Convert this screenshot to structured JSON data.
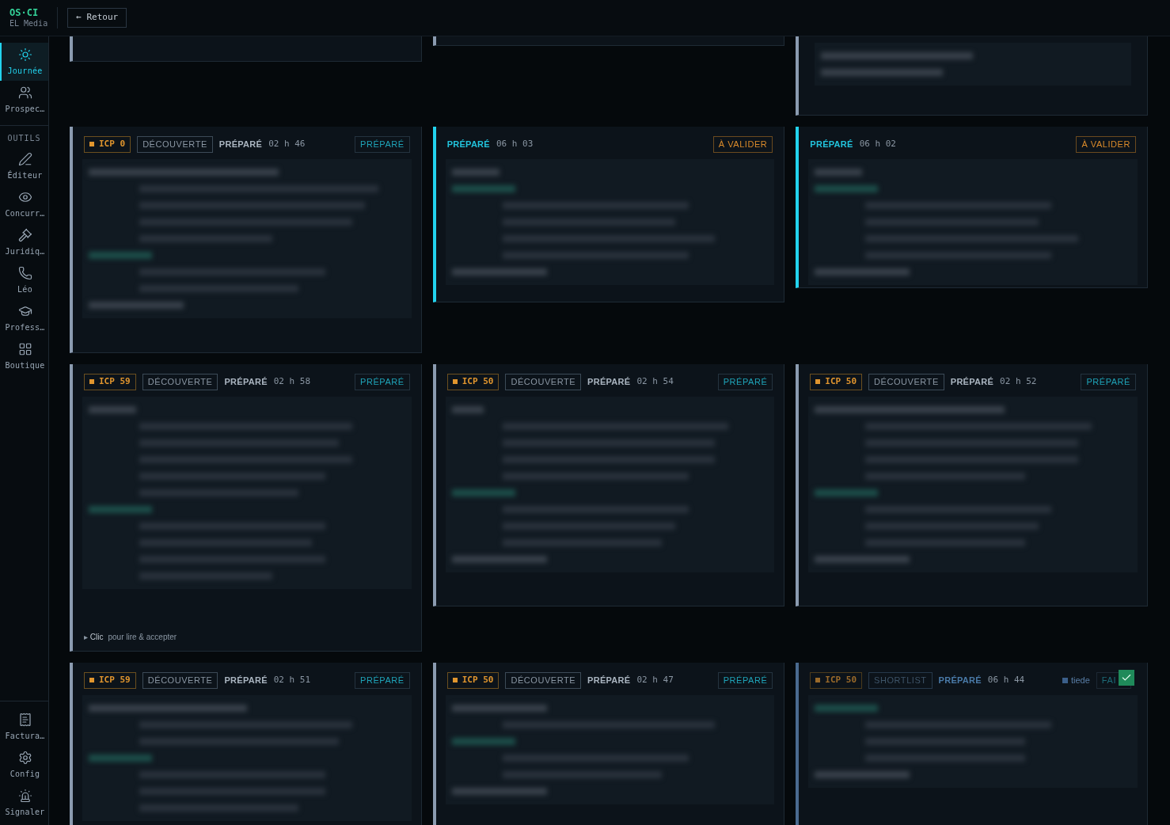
{
  "brand": {
    "name": "OS·CI",
    "subtitle": "EL Media"
  },
  "back_button": "← Retour",
  "sidebar": {
    "main": [
      {
        "label": "Journée",
        "selected": true
      },
      {
        "label": "Prospec…",
        "selected": false
      }
    ],
    "section_label": "OUTILS",
    "tools": [
      {
        "label": "Éditeur",
        "selected": false
      },
      {
        "label": "Concurr…",
        "selected": false
      },
      {
        "label": "Juridiq…",
        "selected": false
      },
      {
        "label": "Léo",
        "selected": false
      },
      {
        "label": "Profess…",
        "selected": false
      },
      {
        "label": "Boutique",
        "selected": false
      }
    ],
    "bottom": [
      {
        "label": "Factura…",
        "selected": false
      },
      {
        "label": "Config",
        "selected": false
      },
      {
        "label": "Signaler",
        "selected": false
      }
    ]
  },
  "cards": [
    {
      "kind": "partial",
      "highlighted": false
    },
    {
      "kind": "partial",
      "highlighted": false
    },
    {
      "kind": "partial",
      "highlighted": false
    },
    {
      "kind": "full",
      "highlighted": false,
      "dimmed": false,
      "icp": "ICP 0",
      "stage": "DÉCOUVERTE",
      "prepared_label": "PRÉPARÉ",
      "prepared_time": "02 h 46",
      "status": {
        "label": "PRÉPARÉ",
        "kind": "prepared"
      }
    },
    {
      "kind": "full",
      "highlighted": true,
      "dimmed": false,
      "prepared_label": "PRÉPARÉ",
      "prepared_time": "06 h 03",
      "status": {
        "label": "À VALIDER",
        "kind": "to_validate"
      }
    },
    {
      "kind": "full",
      "highlighted": true,
      "dimmed": false,
      "prepared_label": "PRÉPARÉ",
      "prepared_time": "06 h 02",
      "status": {
        "label": "À VALIDER",
        "kind": "to_validate"
      }
    },
    {
      "kind": "full",
      "highlighted": false,
      "dimmed": false,
      "icp": "ICP 59",
      "stage": "DÉCOUVERTE",
      "prepared_label": "PRÉPARÉ",
      "prepared_time": "02 h 58",
      "status": {
        "label": "PRÉPARÉ",
        "kind": "prepared"
      },
      "footer": {
        "marker": "▸",
        "action": "Clic",
        "text": "pour lire & accepter"
      }
    },
    {
      "kind": "full",
      "highlighted": false,
      "dimmed": false,
      "icp": "ICP 50",
      "stage": "DÉCOUVERTE",
      "prepared_label": "PRÉPARÉ",
      "prepared_time": "02 h 54",
      "status": {
        "label": "PRÉPARÉ",
        "kind": "prepared"
      }
    },
    {
      "kind": "full",
      "highlighted": false,
      "dimmed": false,
      "icp": "ICP 50",
      "stage": "DÉCOUVERTE",
      "prepared_label": "PRÉPARÉ",
      "prepared_time": "02 h 52",
      "status": {
        "label": "PRÉPARÉ",
        "kind": "prepared"
      }
    },
    {
      "kind": "full",
      "highlighted": false,
      "dimmed": false,
      "icp": "ICP 59",
      "stage": "DÉCOUVERTE",
      "prepared_label": "PRÉPARÉ",
      "prepared_time": "02 h 51",
      "status": {
        "label": "PRÉPARÉ",
        "kind": "prepared"
      }
    },
    {
      "kind": "full",
      "highlighted": false,
      "dimmed": false,
      "icp": "ICP 50",
      "stage": "DÉCOUVERTE",
      "prepared_label": "PRÉPARÉ",
      "prepared_time": "02 h 47",
      "status": {
        "label": "PRÉPARÉ",
        "kind": "prepared"
      }
    },
    {
      "kind": "full",
      "highlighted": false,
      "dimmed": true,
      "icp": "ICP 50",
      "stage": "SHORTLIST",
      "prepared_label": "PRÉPARÉ",
      "prepared_time": "06 h 44",
      "temperature": {
        "label": "tiede",
        "color": "#3b5f8a"
      },
      "status": {
        "label": "FAI",
        "kind": "prepared"
      },
      "done": true
    }
  ]
}
